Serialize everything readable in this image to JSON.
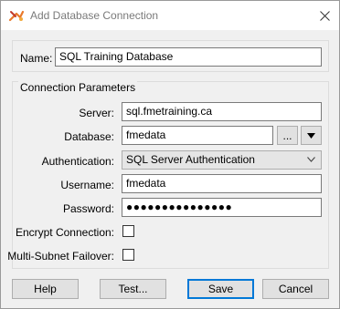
{
  "window": {
    "title": "Add Database Connection",
    "app_icon": "fme-workbench-icon",
    "close_icon": "close-icon"
  },
  "name": {
    "label": "Name:",
    "value": "SQL Training Database"
  },
  "connection": {
    "group_title": "Connection Parameters",
    "server_label": "Server:",
    "server_value": "sql.fmetraining.ca",
    "database_label": "Database:",
    "database_value": "fmedata",
    "browse_label": "...",
    "dropdown_icon": "triangle-down-icon",
    "authentication_label": "Authentication:",
    "authentication_value": "SQL Server Authentication",
    "username_label": "Username:",
    "username_value": "fmedata",
    "password_label": "Password:",
    "password_value": "●●●●●●●●●●●●●●●",
    "encrypt_label": "Encrypt Connection:",
    "encrypt_checked": false,
    "multisubnet_label": "Multi-Subnet Failover:",
    "multisubnet_checked": false
  },
  "buttons": {
    "help": "Help",
    "test": "Test...",
    "save": "Save",
    "cancel": "Cancel"
  }
}
